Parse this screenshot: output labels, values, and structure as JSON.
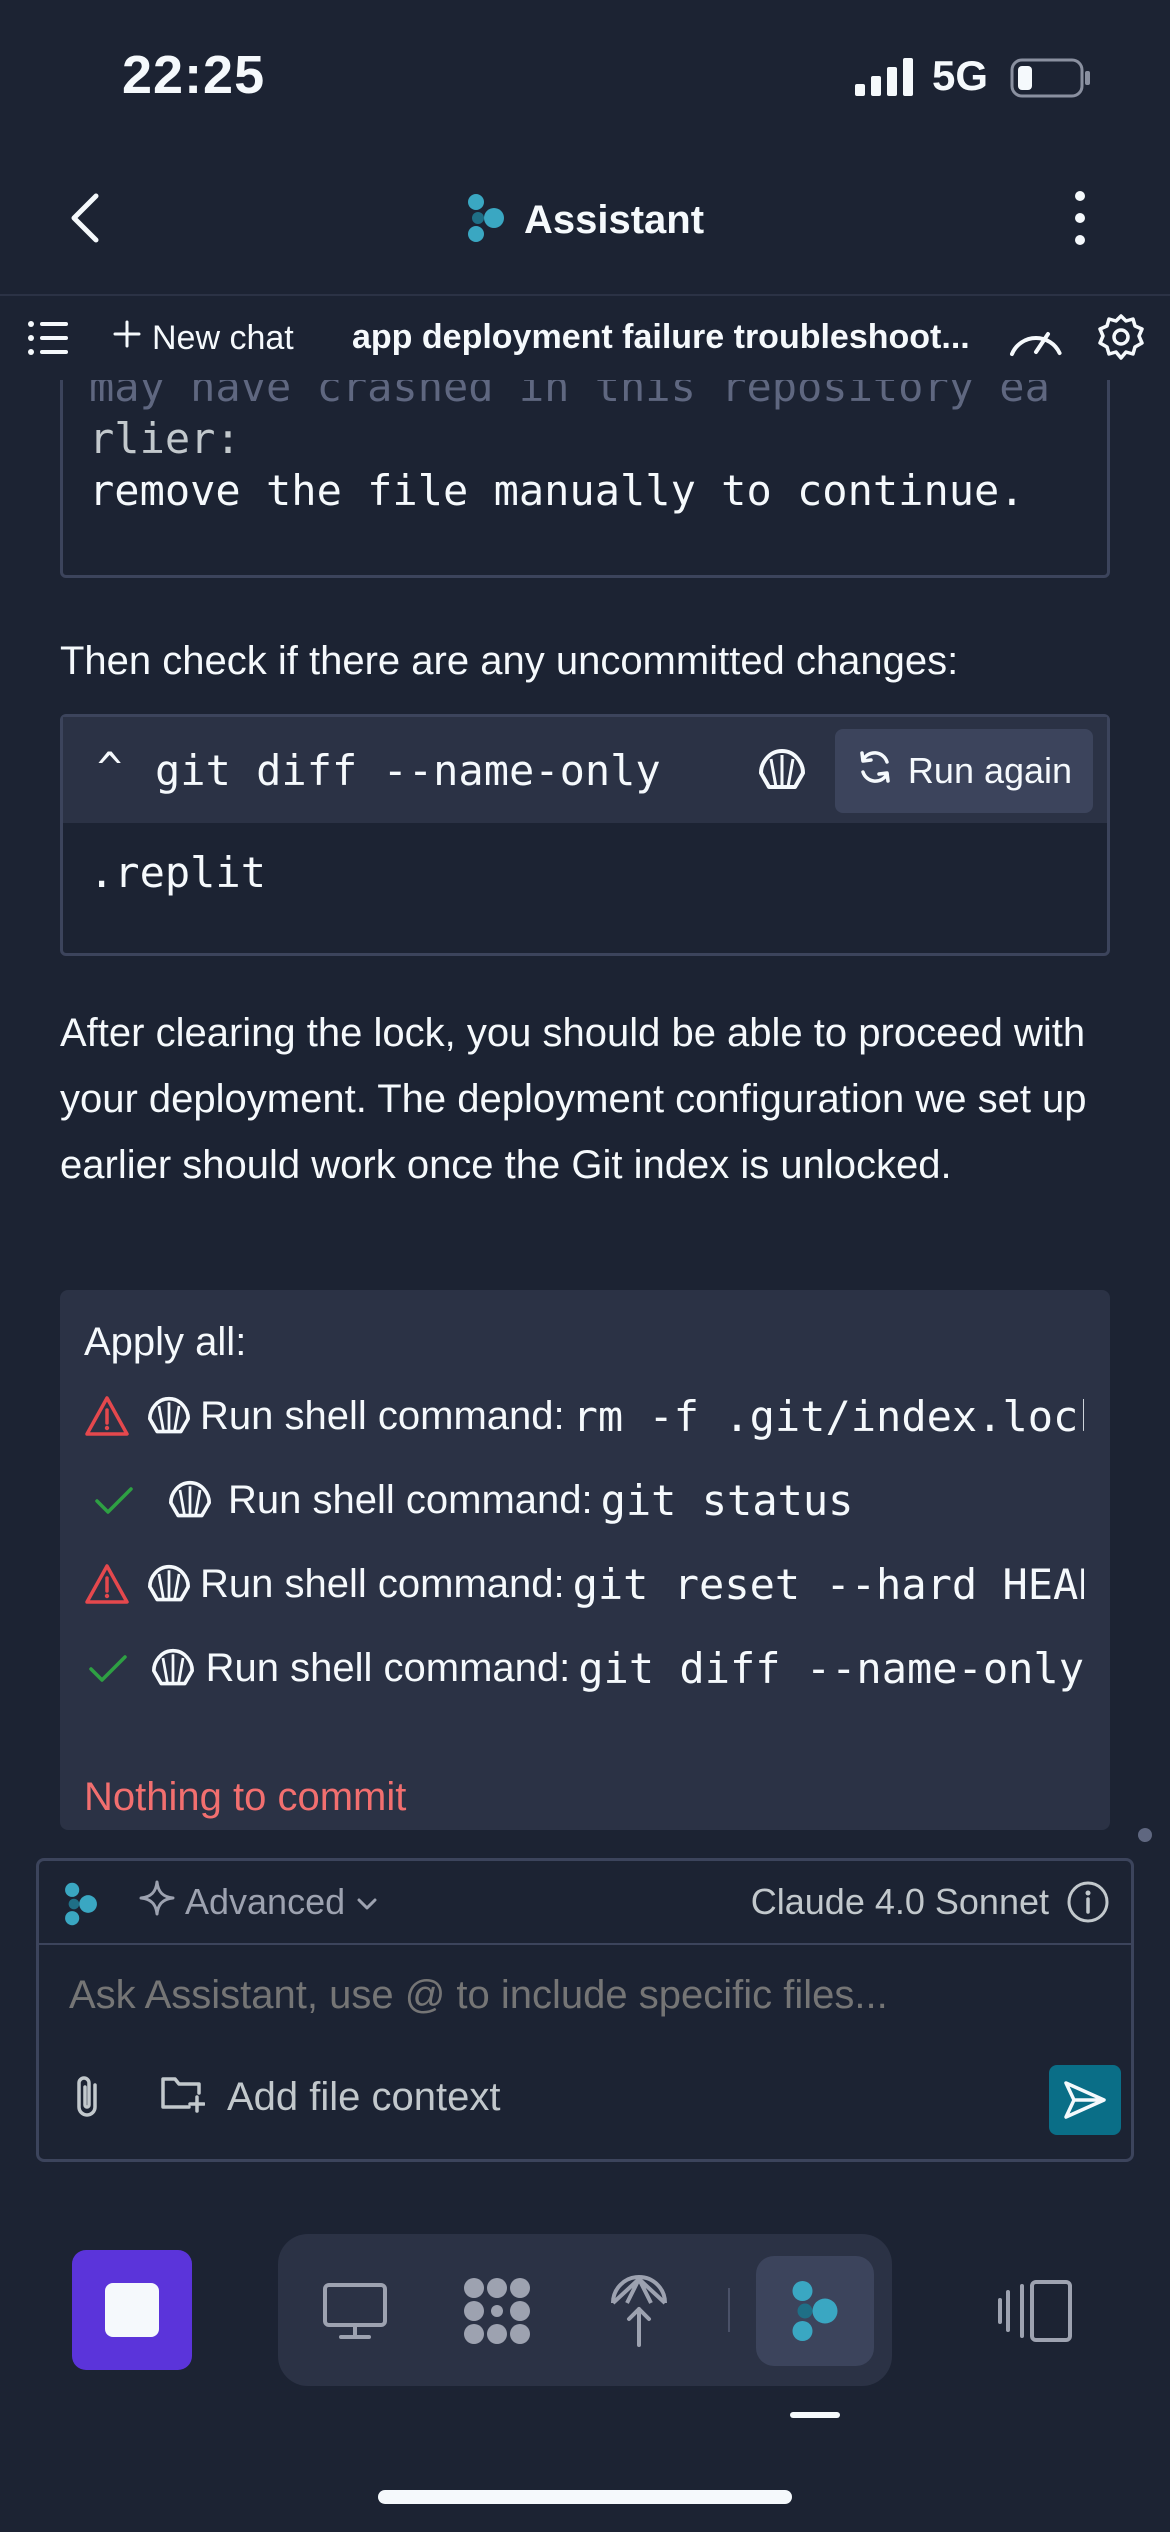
{
  "status_bar": {
    "time": "22:25",
    "network": "5G"
  },
  "header": {
    "title": "Assistant",
    "logo_color": "#3aa7c2"
  },
  "toolbar": {
    "new_chat_label": "New chat",
    "chat_title": "app deployment failure troubleshoot..."
  },
  "chat": {
    "first_code_lines": [
      "may have crashed in this repository ea",
      "rlier:",
      "remove the file manually to continue."
    ],
    "check_text": "Then check if there are any uncommitted changes:",
    "command_block": {
      "command": "git diff --name-only",
      "run_again_label": "Run again",
      "output": ".replit"
    },
    "after_text": "After clearing the lock, you should be able to proceed with your deployment. The deployment configuration we set up earlier should work once the Git index is unlocked."
  },
  "apply_all": {
    "title": "Apply all:",
    "items": [
      {
        "status": "warning",
        "label": "Run shell command:",
        "command": "rm -f .git/index.lock"
      },
      {
        "status": "success",
        "label": "Run shell command:",
        "command": "git status"
      },
      {
        "status": "warning",
        "label": "Run shell command:",
        "command": "git reset --hard HEAD"
      },
      {
        "status": "success",
        "label": "Run shell command:",
        "command": "git diff --name-only"
      }
    ],
    "result": "Nothing to commit"
  },
  "composer": {
    "mode": "Advanced",
    "model": "Claude 4.0 Sonnet",
    "placeholder": "Ask Assistant, use @ to include specific files...",
    "add_context_label": "Add file context"
  },
  "colors": {
    "background": "#1c2333",
    "surface": "#2b3245",
    "border": "#3c445c",
    "warning": "#e5484d",
    "success": "#2ea043",
    "error_text": "#f26f6f",
    "accent": "#0a6e87",
    "stop": "#5b34da"
  },
  "bottom_bar": {
    "tabs": [
      "webview-icon",
      "workspace-icon",
      "deployments-icon",
      "assistant-icon"
    ],
    "active_tab": "assistant-icon"
  }
}
